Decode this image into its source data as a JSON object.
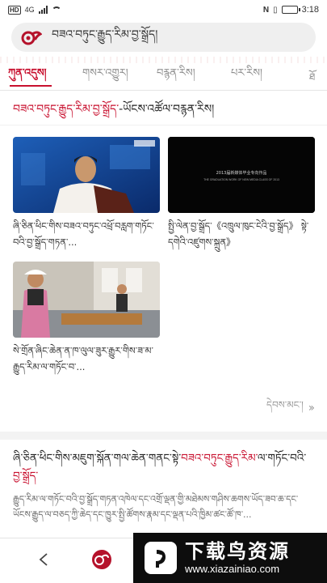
{
  "status_bar": {
    "network_badge": "HD",
    "network_type": "4G",
    "battery_percent": 90,
    "time": "3:18"
  },
  "search": {
    "query": "བཟའ་བཏུང་རྒྱུད་རིམ་བྱ་སྒྲོད།"
  },
  "tabs": [
    {
      "label": "ཀུན་འདུས།",
      "active": true
    },
    {
      "label": "གསར་འགྱུར།",
      "active": false
    },
    {
      "label": "བརྙན་རིས།",
      "active": false
    },
    {
      "label": "པར་རིས།",
      "active": false
    }
  ],
  "tabs_more": "ཐོ",
  "section": {
    "title_red": "བཟའ་བཏུང་རྒྱུད་རིམ་བྱ་སྒྲོད་",
    "title_rest": "-ཡོངས་འཚོལ་བརྙན་རིས།"
  },
  "cards": [
    {
      "caption": "ཞི་ཅིན་ཕིང་གིས་བཟའ་བཏུང་འཕྲོ་བརླག་གཏོང་བའི་བྱ་སྒྲོད་གཏན་..."
    },
    {
      "caption": "སྤྱི་ལེན་བྱ་སྒྲོད་《འཁྲུལ་ཁུང་ངེའི་བྱ་སྒྲོད》 སྟེ་དགེའི་འཛུགས་སྐྲུན》",
      "overlay_line1": "2013届新媒体毕业专向作品",
      "overlay_line2": "THE GRADUATION WORK OF NEW MEDIA CLASS OF 2013"
    },
    {
      "caption": "སེ་གྲོན་ཞིང་ཆེན་ན་ཁ་ལུལ་ཟུར་རྒྱུར་གིས་ཟ་མ་རྒྱུད་རིམ་ལ་གཏོང་བ་..."
    }
  ],
  "more_label": "དེབས་མང་།",
  "article": {
    "title_black": "ཞི་ཅིན་ཕིང་གིས་མཇུག་སྐོན་གལ་ཆེན་གནང་སྟེ་",
    "title_red": "བཟའ་བཏུང་རྒྱུད་རིམ་",
    "title_tail": "ལ་གཏོང་བའི་",
    "title_red2": "བྱ་སྒྲོད་",
    "body": "རྒྱུད་རིམ་ལ་གཏོང་བའི་བྱ་སྒྲོད་གཏན་འཁེལ་དང་འགྲོ་ལྡན་གྱི་མཐེམས་གཤིས་ཆགས་ཡོད་ཟབ་ཆ་དང་ཡོངས་རྒྱུད་ལ་བཅད་ཀྱི་ཆེད་དང་ཁྱུར་སྤྱི་ཚོགས་རྣམ་དང་ལྡན་པའི་ཁྱིམ་ཚང་ཚོ་ཁ་..."
  },
  "bottom_nav": {
    "back_icon": "chevron-left-icon",
    "logo_icon": "app-logo-icon"
  },
  "watermark": {
    "text": "下载鸟资源",
    "url": "www.xiazainiao.com"
  },
  "colors": {
    "accent": "#c8102e",
    "search_bg": "#efefef"
  }
}
